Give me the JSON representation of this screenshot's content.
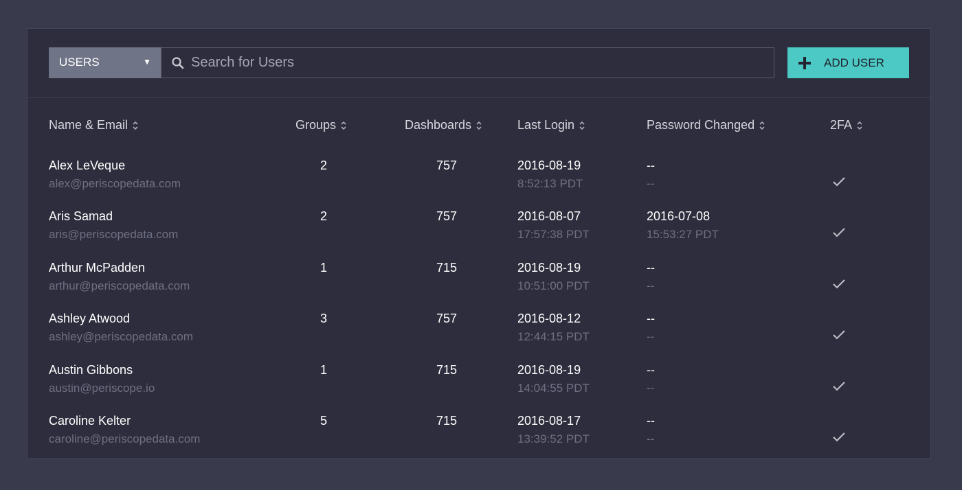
{
  "toolbar": {
    "select_value": "USERS",
    "search_placeholder": "Search for Users",
    "add_button_label": "ADD USER"
  },
  "columns": [
    "Name & Email",
    "Groups",
    "Dashboards",
    "Last Login",
    "Password Changed",
    "2FA"
  ],
  "rows": [
    {
      "name": "Alex LeVeque",
      "email": "alex@periscopedata.com",
      "groups": "2",
      "dashboards": "757",
      "last_login_date": "2016-08-19",
      "last_login_time": "8:52:13 PDT",
      "pw_date": "--",
      "pw_time": "--",
      "twofa": true
    },
    {
      "name": "Aris Samad",
      "email": "aris@periscopedata.com",
      "groups": "2",
      "dashboards": "757",
      "last_login_date": "2016-08-07",
      "last_login_time": "17:57:38 PDT",
      "pw_date": "2016-07-08",
      "pw_time": "15:53:27 PDT",
      "twofa": true
    },
    {
      "name": "Arthur McPadden",
      "email": "arthur@periscopedata.com",
      "groups": "1",
      "dashboards": "715",
      "last_login_date": "2016-08-19",
      "last_login_time": "10:51:00 PDT",
      "pw_date": "--",
      "pw_time": "--",
      "twofa": true
    },
    {
      "name": "Ashley Atwood",
      "email": "ashley@periscopedata.com",
      "groups": "3",
      "dashboards": "757",
      "last_login_date": "2016-08-12",
      "last_login_time": "12:44:15 PDT",
      "pw_date": "--",
      "pw_time": "--",
      "twofa": true
    },
    {
      "name": "Austin Gibbons",
      "email": "austin@periscope.io",
      "groups": "1",
      "dashboards": "715",
      "last_login_date": "2016-08-19",
      "last_login_time": "14:04:55 PDT",
      "pw_date": "--",
      "pw_time": "--",
      "twofa": true
    },
    {
      "name": "Caroline Kelter",
      "email": "caroline@periscopedata.com",
      "groups": "5",
      "dashboards": "715",
      "last_login_date": "2016-08-17",
      "last_login_time": "13:39:52 PDT",
      "pw_date": "--",
      "pw_time": "--",
      "twofa": true
    }
  ],
  "icons": {
    "search": "search-icon",
    "chevron": "chevron-down-icon",
    "plus": "plus-icon",
    "sort": "sort-icon",
    "check": "checkmark-icon"
  },
  "colors": {
    "accent": "#4cc9c4",
    "panel": "#2e2d3d",
    "background": "#3a3a4d",
    "muted_text": "#6e7083"
  }
}
